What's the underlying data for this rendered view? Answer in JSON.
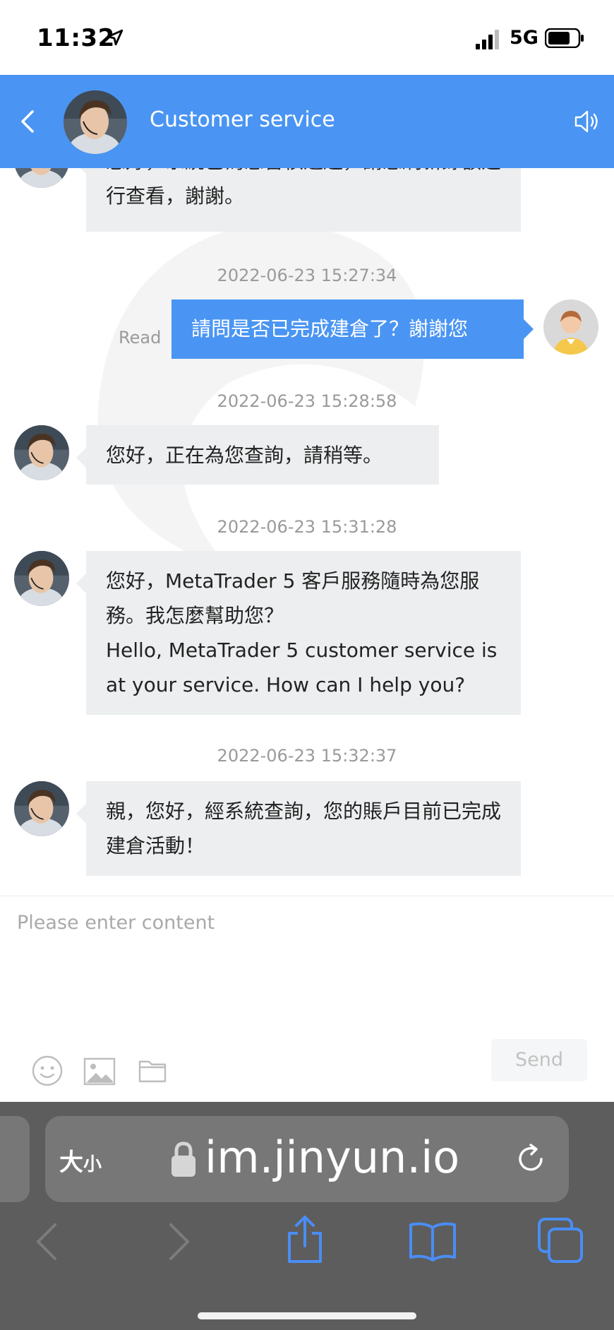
{
  "status": {
    "time": "11:32",
    "network": "5G"
  },
  "header": {
    "title": "Customer service"
  },
  "messages": {
    "m0": "您好，系統已為您審核通過，請您刷新餘額進行查看，謝謝。",
    "t1": "2022-06-23 15:27:34",
    "m1": "請問是否已完成建倉了？謝謝您",
    "read": "Read",
    "t2": "2022-06-23 15:28:58",
    "m2": "您好，正在為您查詢，請稍等。",
    "t3": "2022-06-23 15:31:28",
    "m3a": "您好，MetaTrader 5 客戶服務隨時為您服務。我怎麼幫助您？",
    "m3b": "Hello, MetaTrader 5 customer service is at your service. How can I help you?",
    "t4": "2022-06-23 15:32:37",
    "m4": "親，您好，經系統查詢，您的賬戶目前已完成建倉活動！"
  },
  "input": {
    "placeholder": "Please enter content",
    "send_label": "Send"
  },
  "browser": {
    "aa_big": "大",
    "aa_small": "小",
    "url": "im.jinyun.io"
  },
  "icons": [
    "location-arrow-icon",
    "signal-icon",
    "battery-icon",
    "back-chevron-icon",
    "speaker-icon",
    "emoji-icon",
    "image-icon",
    "folder-icon",
    "lock-icon",
    "reload-icon",
    "nav-back-icon",
    "nav-forward-icon",
    "share-icon",
    "bookmarks-icon",
    "tabs-icon"
  ],
  "colors": {
    "header_blue": "#4a95f3",
    "bubble_gray": "#eceeef",
    "browser_bar": "#5d5d5d",
    "ios_blue": "#4a8df5"
  }
}
